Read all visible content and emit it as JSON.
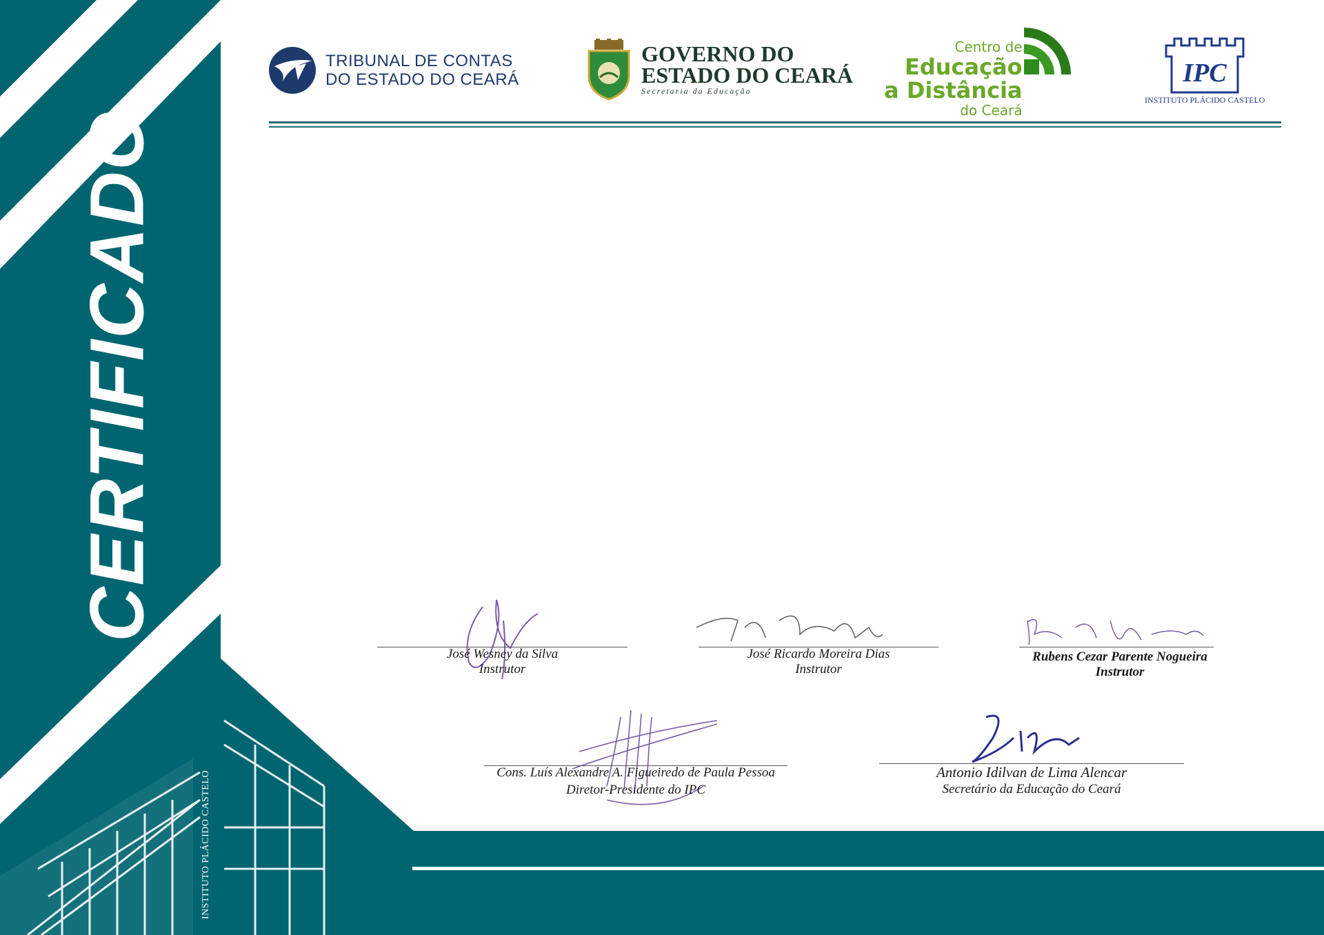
{
  "colors": {
    "teal": "#006570",
    "teal_dark": "#004f57",
    "white": "#ffffff",
    "navy": "#1e3a6d",
    "green": "#6aa82a",
    "signature_purple": "#7a5aa8",
    "signature_blue": "#2b2f8f"
  },
  "side_panel": {
    "title": "CERTIFICADO",
    "institute_vertical": "INSTITUTO PLÁCIDO CASTELO"
  },
  "header": {
    "tce": {
      "icon": "tce-emblem-icon",
      "line1": "TRIBUNAL DE CONTAS",
      "line2": "DO ESTADO DO CEARÁ"
    },
    "governo": {
      "icon": "ceara-coat-of-arms-icon",
      "line1": "GOVERNO DO",
      "line2": "ESTADO DO CEARÁ",
      "sub": "Secretaria da Educação"
    },
    "ced": {
      "icon": "wireless-signal-icon",
      "line1": "Centro de",
      "line2": "Educação",
      "line3": "a Distância",
      "line4": "do Ceará"
    },
    "ipc": {
      "icon": "castle-tower-icon",
      "monogram": "IPC",
      "caption": "INSTITUTO PLÁCIDO CASTELO"
    }
  },
  "signatures": {
    "row1": [
      {
        "name": "José Wesney da Silva",
        "role": "Instrutor"
      },
      {
        "name": "José Ricardo Moreira Dias",
        "role": "Instrutor"
      },
      {
        "name": "Rubens Cezar Parente Nogueira",
        "role": "Instrutor"
      }
    ],
    "row2": [
      {
        "name": "Cons. Luís Alexandre A. Figueiredo de Paula Pessoa",
        "role": "Diretor-Presidente do IPC"
      },
      {
        "name": "Antonio Idilvan de Lima Alencar",
        "role": "Secretário da Educação do Ceará"
      }
    ]
  }
}
